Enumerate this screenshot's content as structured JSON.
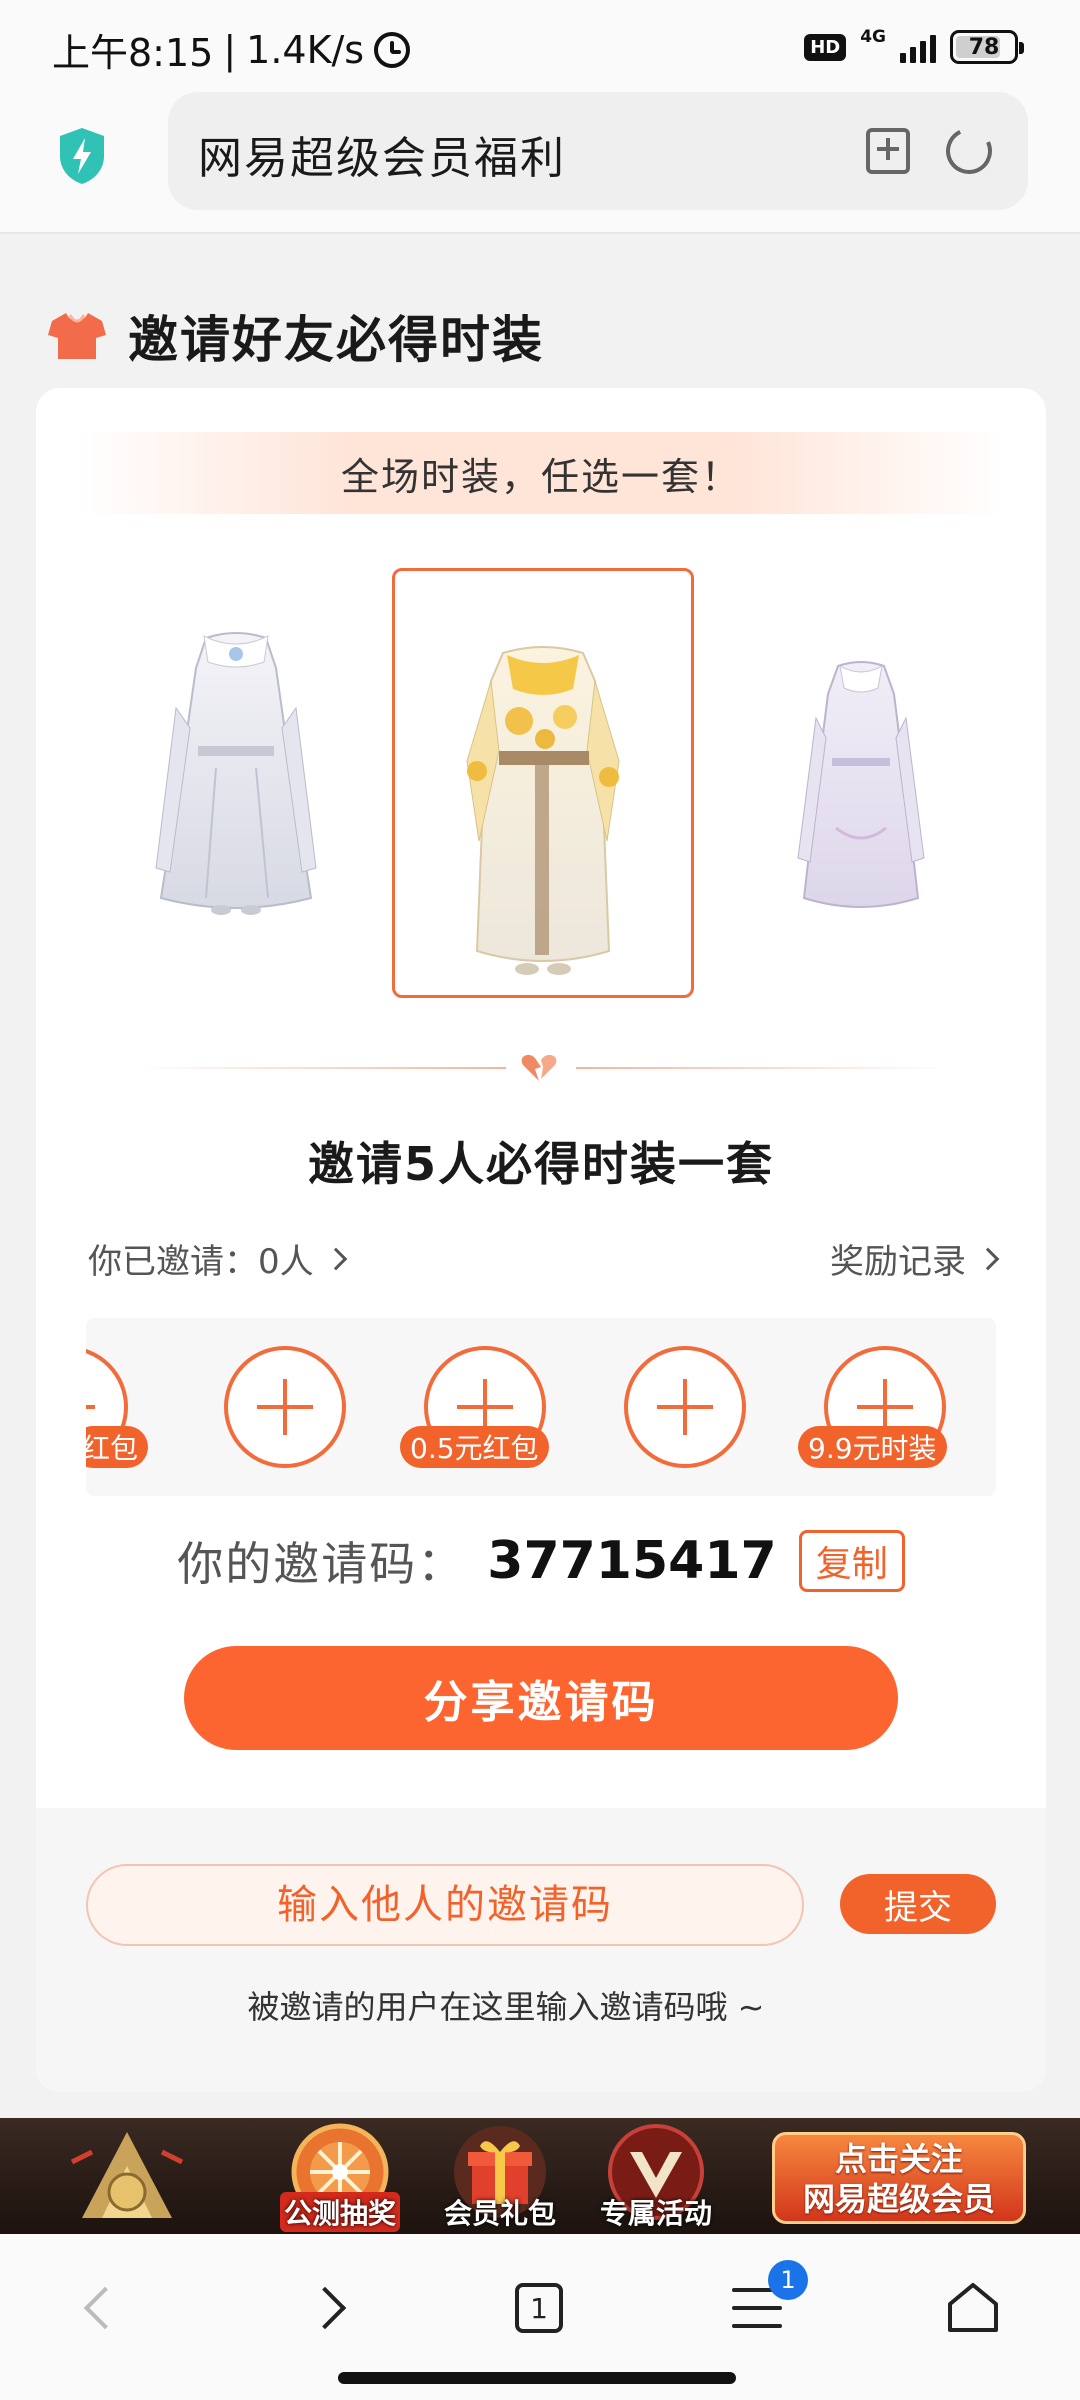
{
  "status_bar": {
    "time": "上午8:15",
    "net_speed": "1.4K/s",
    "separator": "|",
    "hd": "HD",
    "network": "4G",
    "battery": "78",
    "battery_level": 0.78
  },
  "address_bar": {
    "title": "网易超级会员福利",
    "icons": [
      "shield-icon",
      "bookmark-add-icon",
      "reload-icon"
    ]
  },
  "section": {
    "title": "邀请好友必得时装",
    "icon": "tshirt-icon"
  },
  "card": {
    "banner": "全场时装，任选一套！",
    "outfits": [
      {
        "name": "white-silver-outfit",
        "selected": false
      },
      {
        "name": "gold-white-outfit",
        "selected": true
      },
      {
        "name": "lavender-white-outfit",
        "selected": false
      }
    ],
    "headline": "邀请5人必得时装一套",
    "invited_label": "你已邀请：0人",
    "reward_record": "奖励记录",
    "slots": [
      {
        "badge": "红包"
      },
      {
        "badge": ""
      },
      {
        "badge": "0.5元红包"
      },
      {
        "badge": ""
      },
      {
        "badge": "9.9元时装"
      }
    ],
    "code_label": "你的邀请码：",
    "code_value": "37715417",
    "copy": "复制",
    "share": "分享邀请码",
    "input_placeholder": "输入他人的邀请码",
    "submit": "提交",
    "hint": "被邀请的用户在这里输入邀请码哦 ~"
  },
  "promo": {
    "items": [
      "公测抽奖",
      "会员礼包",
      "专属活动"
    ],
    "cta_line1": "点击关注",
    "cta_line2": "网易超级会员"
  },
  "bottom_nav": {
    "tab_count": "1",
    "menu_badge": "1"
  },
  "colors": {
    "accent": "#f2622b",
    "share_button": "#fd6530",
    "badge_blue": "#1a73e8"
  }
}
